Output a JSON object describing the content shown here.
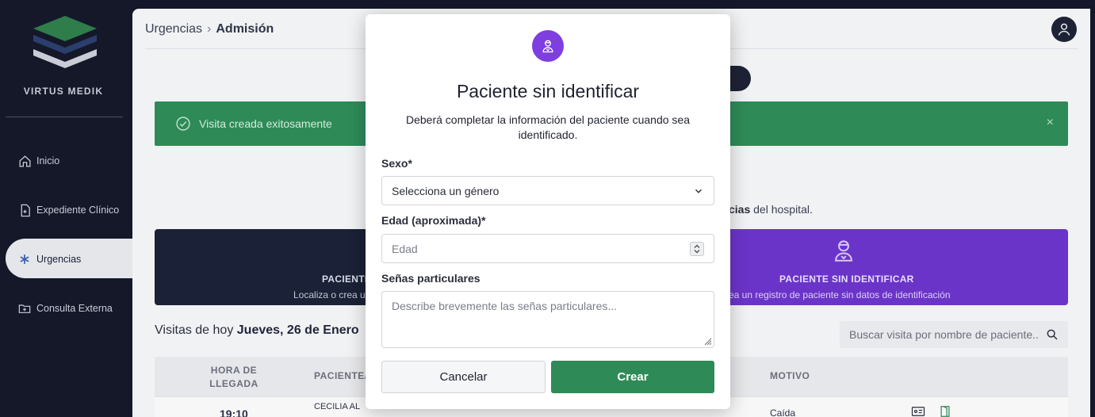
{
  "sidebar": {
    "brand": "VIRTUS MEDIK",
    "items": [
      {
        "label": "Inicio",
        "icon": "home-icon"
      },
      {
        "label": "Expediente Clínico",
        "icon": "document-plus-icon"
      },
      {
        "label": "Urgencias",
        "icon": "asterisk-icon",
        "active": true
      },
      {
        "label": "Consulta Externa",
        "icon": "folder-plus-icon"
      }
    ]
  },
  "header": {
    "breadcrumb_root": "Urgencias",
    "breadcrumb_current": "Admisión",
    "separator": "›"
  },
  "alert": {
    "message": "Visita creada exitosamente",
    "close": "×",
    "color": "#2e8b57"
  },
  "helper": {
    "bold": "cias",
    "rest": " del hospital."
  },
  "cards": {
    "left_title": "PACIENTE",
    "left_desc": "Localiza o crea u",
    "right_title": "PACIENTE SIN IDENTIFICAR",
    "right_desc": "ea un registro de paciente sin datos de identificación",
    "right_color": "#6b34c9"
  },
  "visits": {
    "prefix": "Visitas de hoy ",
    "date": "Jueves, 26 de Enero"
  },
  "search": {
    "placeholder": "Buscar visita por nombre de paciente..."
  },
  "table": {
    "headers": {
      "arrival": "HORA DE LLEGADA",
      "patient": "PACIENTE/",
      "reason": "MOTIVO"
    },
    "rows": [
      {
        "time": "19:10",
        "patient": "CECILIA AL",
        "reason": "Caída"
      }
    ]
  },
  "modal": {
    "title": "Paciente sin identificar",
    "description": "Deberá completar la información del paciente cuando sea identificado.",
    "sex_label": "Sexo*",
    "sex_value": "Selecciona un género",
    "age_label": "Edad (aproximada)*",
    "age_placeholder": "Edad",
    "marks_label": "Señas particulares",
    "marks_placeholder": "Describe brevemente las señas particulares...",
    "cancel": "Cancelar",
    "create": "Crear",
    "icon_color": "#7e3ee0"
  }
}
